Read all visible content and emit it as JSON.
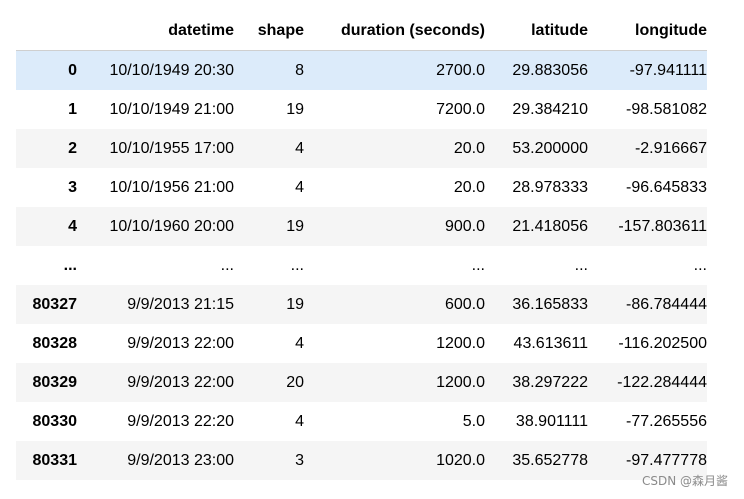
{
  "table": {
    "columns": [
      "",
      "datetime",
      "shape",
      "duration (seconds)",
      "latitude",
      "longitude"
    ],
    "rows": [
      {
        "index": "0",
        "datetime": "10/10/1949 20:30",
        "shape": "8",
        "duration": "2700.0",
        "latitude": "29.883056",
        "longitude": "-97.941111"
      },
      {
        "index": "1",
        "datetime": "10/10/1949 21:00",
        "shape": "19",
        "duration": "7200.0",
        "latitude": "29.384210",
        "longitude": "-98.581082"
      },
      {
        "index": "2",
        "datetime": "10/10/1955 17:00",
        "shape": "4",
        "duration": "20.0",
        "latitude": "53.200000",
        "longitude": "-2.916667"
      },
      {
        "index": "3",
        "datetime": "10/10/1956 21:00",
        "shape": "4",
        "duration": "20.0",
        "latitude": "28.978333",
        "longitude": "-96.645833"
      },
      {
        "index": "4",
        "datetime": "10/10/1960 20:00",
        "shape": "19",
        "duration": "900.0",
        "latitude": "21.418056",
        "longitude": "-157.803611"
      },
      {
        "index": "...",
        "datetime": "...",
        "shape": "...",
        "duration": "...",
        "latitude": "...",
        "longitude": "..."
      },
      {
        "index": "80327",
        "datetime": "9/9/2013 21:15",
        "shape": "19",
        "duration": "600.0",
        "latitude": "36.165833",
        "longitude": "-86.784444"
      },
      {
        "index": "80328",
        "datetime": "9/9/2013 22:00",
        "shape": "4",
        "duration": "1200.0",
        "latitude": "43.613611",
        "longitude": "-116.202500"
      },
      {
        "index": "80329",
        "datetime": "9/9/2013 22:00",
        "shape": "20",
        "duration": "1200.0",
        "latitude": "38.297222",
        "longitude": "-122.284444"
      },
      {
        "index": "80330",
        "datetime": "9/9/2013 22:20",
        "shape": "4",
        "duration": "5.0",
        "latitude": "38.901111",
        "longitude": "-77.265556"
      },
      {
        "index": "80331",
        "datetime": "9/9/2013 23:00",
        "shape": "3",
        "duration": "1020.0",
        "latitude": "35.652778",
        "longitude": "-97.477778"
      }
    ],
    "hovered_row": 0
  },
  "watermark": "CSDN @森月酱"
}
